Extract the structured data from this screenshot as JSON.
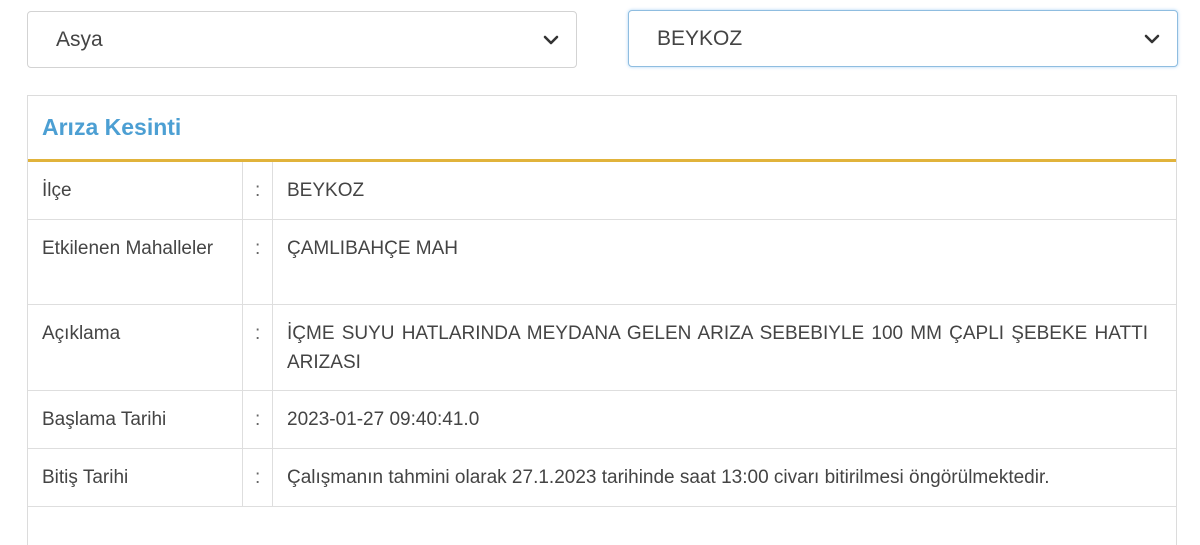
{
  "filters": {
    "region_value": "Asya",
    "district_value": "BEYKOZ",
    "chevron_icon": "chevron-down-icon"
  },
  "panel": {
    "title": "Arıza Kesinti",
    "accent_color": "#e1b33b",
    "title_color": "#4c9fd3",
    "separator": ":",
    "rows": [
      {
        "label": "İlçe",
        "value": "BEYKOZ"
      },
      {
        "label": "Etkilenen Mahalleler",
        "value": "ÇAMLIBAHÇE MAH"
      },
      {
        "label": "Açıklama",
        "value": "İÇME SUYU HATLARINDA MEYDANA GELEN ARIZA SEBEBIYLE 100 MM ÇAPLI ŞEBEKE HATTI ARIZASI"
      },
      {
        "label": "Başlama Tarihi",
        "value": "2023-01-27 09:40:41.0"
      },
      {
        "label": "Bitiş Tarihi",
        "value": "Çalışmanın tahmini olarak 27.1.2023 tarihinde saat 13:00 civarı bitirilmesi öngörülmektedir."
      }
    ]
  }
}
